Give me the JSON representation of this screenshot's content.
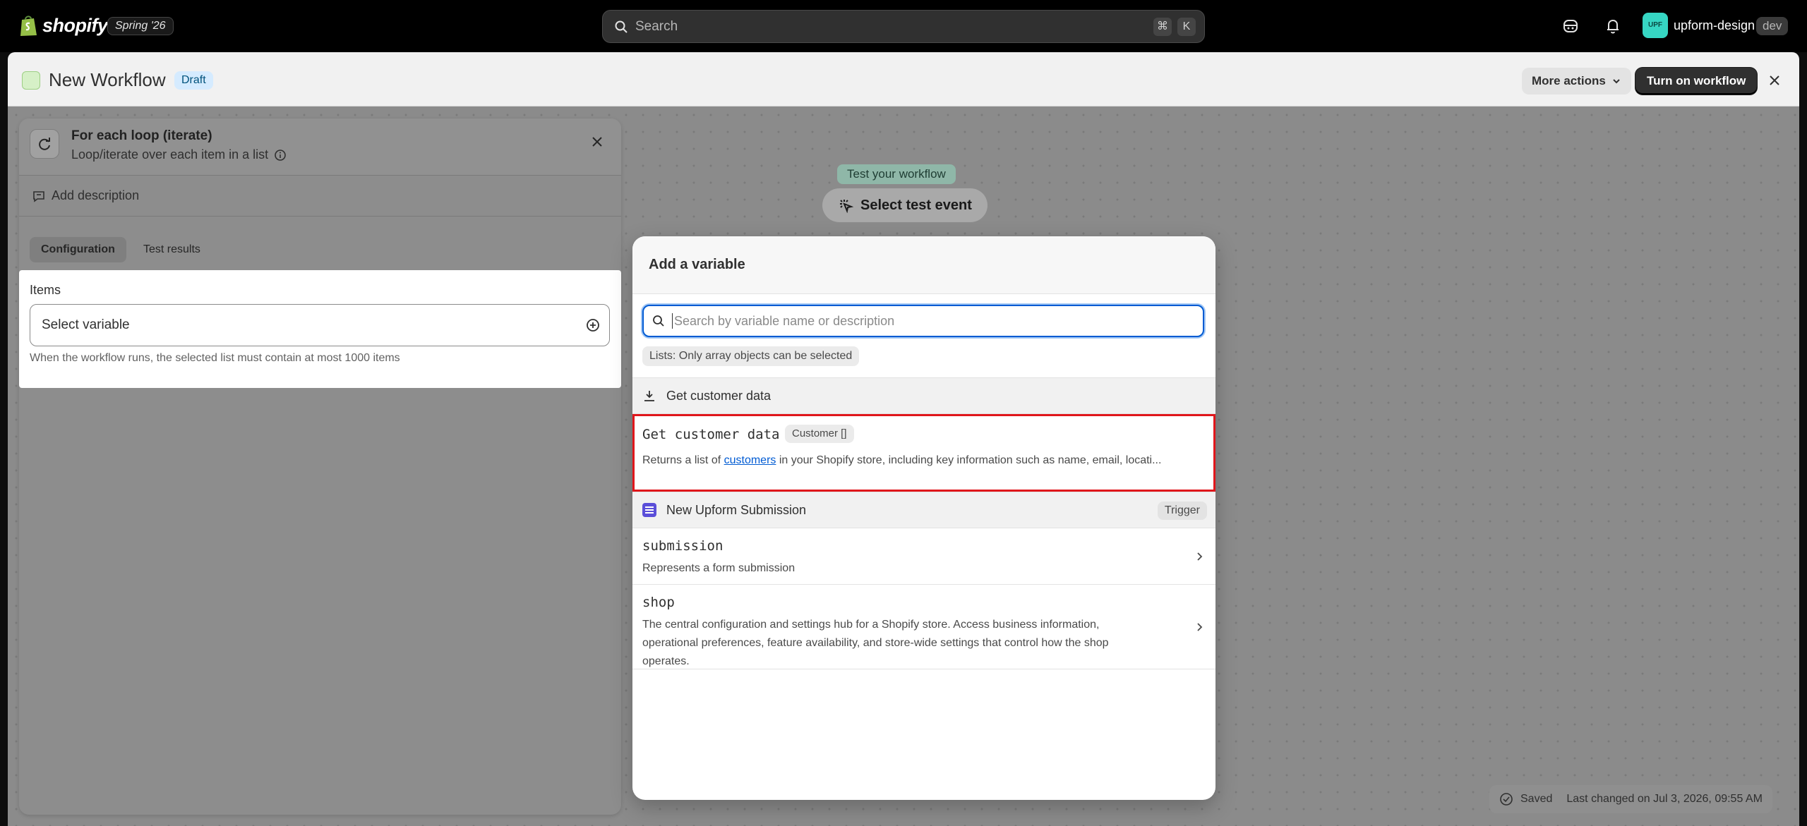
{
  "topbar": {
    "logo_text": "shopify",
    "edition": "Spring '26",
    "search_placeholder": "Search",
    "shortcut_cmd": "⌘",
    "shortcut_key": "K",
    "avatar_initials": "UPF",
    "store_name": "upform-design",
    "store_badge": "dev"
  },
  "workflow": {
    "title": "New Workflow",
    "status": "Draft",
    "more_actions": "More actions",
    "turn_on": "Turn on workflow"
  },
  "canvas": {
    "test_label": "Test your workflow",
    "select_test_event": "Select test event"
  },
  "panel": {
    "title": "For each loop (iterate)",
    "subtitle": "Loop/iterate over each item in a list",
    "add_description": "Add description",
    "tabs": [
      {
        "label": "Configuration",
        "active": true
      },
      {
        "label": "Test results",
        "active": false
      }
    ],
    "items_label": "Items",
    "items_value": "Select variable",
    "items_help": "When the workflow runs, the selected list must contain at most 1000 items"
  },
  "popover": {
    "title": "Add a variable",
    "search_placeholder": "Search by variable name or description",
    "note": "Lists: Only array objects can be selected",
    "groups": [
      {
        "label": "Get customer data",
        "icon": "download-icon",
        "badge": "",
        "variables": [
          {
            "name": "Get customer data",
            "type": "Customer []",
            "desc_before": "Returns a list of ",
            "desc_link": "customers",
            "desc_after": " in your Shopify store, including key information such as name, email, locati..."
          }
        ]
      },
      {
        "label": "New Upform Submission",
        "icon": "upform-icon",
        "badge": "Trigger",
        "variables": [
          {
            "name": "submission",
            "desc": "Represents a form submission"
          },
          {
            "name": "shop",
            "desc": "The central configuration and settings hub for a Shopify store. Access business information, operational preferences, feature availability, and store-wide settings that control how the shop operates."
          }
        ]
      }
    ]
  },
  "status": {
    "saved": "Saved",
    "last_changed": "Last changed on Jul 3, 2026, 09:55 AM"
  },
  "colors": {
    "accent_blue": "#005bd3",
    "selection_red": "#e0161b",
    "primary_button": "#303030"
  }
}
